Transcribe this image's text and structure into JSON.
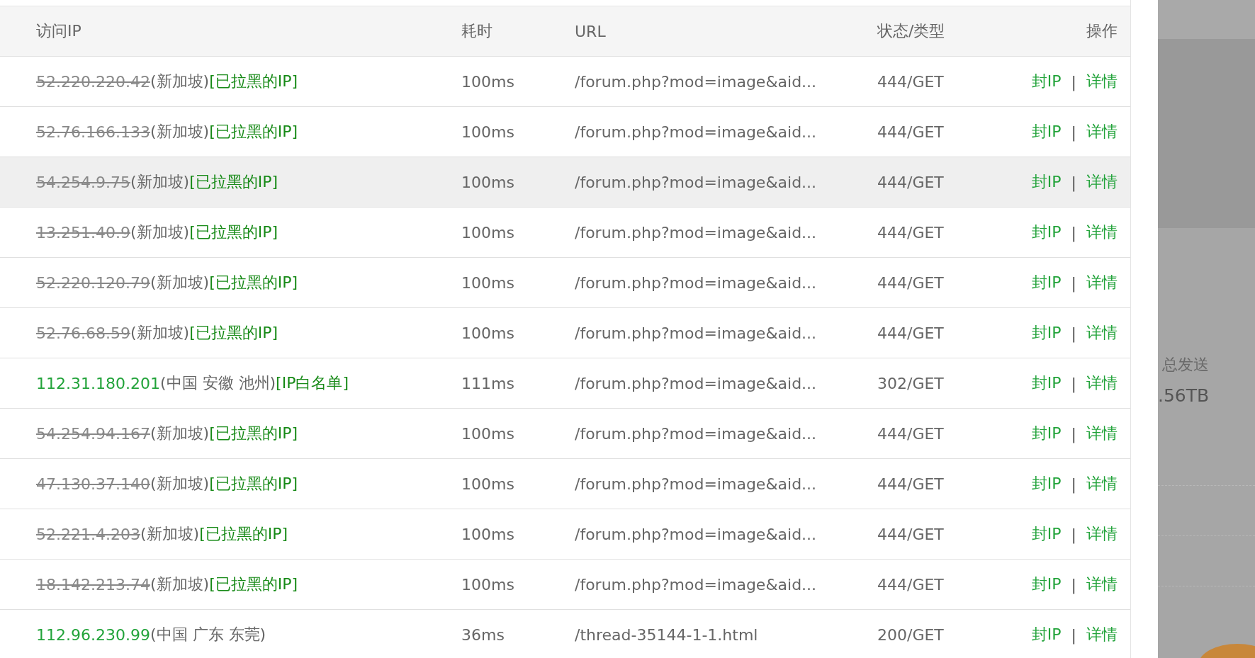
{
  "table": {
    "columns": [
      "访问IP",
      "耗时",
      "URL",
      "状态/类型",
      "操作"
    ],
    "rows": [
      {
        "ip": "52.220.220.42",
        "blacklisted": true,
        "location": "(新加坡)",
        "tag": "[已拉黑的IP]",
        "time": "100ms",
        "url": "/forum.php?mod=image&aid...",
        "status": "444/GET",
        "actions": [
          "封IP",
          "详情"
        ],
        "separator": "|",
        "hovered": false
      },
      {
        "ip": "52.76.166.133",
        "blacklisted": true,
        "location": "(新加坡)",
        "tag": "[已拉黑的IP]",
        "time": "100ms",
        "url": "/forum.php?mod=image&aid...",
        "status": "444/GET",
        "actions": [
          "封IP",
          "详情"
        ],
        "separator": "|",
        "hovered": false
      },
      {
        "ip": "54.254.9.75",
        "blacklisted": true,
        "location": "(新加坡)",
        "tag": "[已拉黑的IP]",
        "time": "100ms",
        "url": "/forum.php?mod=image&aid...",
        "status": "444/GET",
        "actions": [
          "封IP",
          "详情"
        ],
        "separator": "|",
        "hovered": true
      },
      {
        "ip": "13.251.40.9",
        "blacklisted": true,
        "location": "(新加坡)",
        "tag": "[已拉黑的IP]",
        "time": "100ms",
        "url": "/forum.php?mod=image&aid...",
        "status": "444/GET",
        "actions": [
          "封IP",
          "详情"
        ],
        "separator": "|",
        "hovered": false
      },
      {
        "ip": "52.220.120.79",
        "blacklisted": true,
        "location": "(新加坡)",
        "tag": "[已拉黑的IP]",
        "time": "100ms",
        "url": "/forum.php?mod=image&aid...",
        "status": "444/GET",
        "actions": [
          "封IP",
          "详情"
        ],
        "separator": "|",
        "hovered": false
      },
      {
        "ip": "52.76.68.59",
        "blacklisted": true,
        "location": "(新加坡)",
        "tag": "[已拉黑的IP]",
        "time": "100ms",
        "url": "/forum.php?mod=image&aid...",
        "status": "444/GET",
        "actions": [
          "封IP",
          "详情"
        ],
        "separator": "|",
        "hovered": false
      },
      {
        "ip": "112.31.180.201",
        "blacklisted": false,
        "location": "(中国 安徽 池州)",
        "tag": "[IP白名单]",
        "time": "111ms",
        "url": "/forum.php?mod=image&aid...",
        "status": "302/GET",
        "actions": [
          "封IP",
          "详情"
        ],
        "separator": "|",
        "hovered": false
      },
      {
        "ip": "54.254.94.167",
        "blacklisted": true,
        "location": "(新加坡)",
        "tag": "[已拉黑的IP]",
        "time": "100ms",
        "url": "/forum.php?mod=image&aid...",
        "status": "444/GET",
        "actions": [
          "封IP",
          "详情"
        ],
        "separator": "|",
        "hovered": false
      },
      {
        "ip": "47.130.37.140",
        "blacklisted": true,
        "location": "(新加坡)",
        "tag": "[已拉黑的IP]",
        "time": "100ms",
        "url": "/forum.php?mod=image&aid...",
        "status": "444/GET",
        "actions": [
          "封IP",
          "详情"
        ],
        "separator": "|",
        "hovered": false
      },
      {
        "ip": "52.221.4.203",
        "blacklisted": true,
        "location": "(新加坡)",
        "tag": "[已拉黑的IP]",
        "time": "100ms",
        "url": "/forum.php?mod=image&aid...",
        "status": "444/GET",
        "actions": [
          "封IP",
          "详情"
        ],
        "separator": "|",
        "hovered": false
      },
      {
        "ip": "18.142.213.74",
        "blacklisted": true,
        "location": "(新加坡)",
        "tag": "[已拉黑的IP]",
        "time": "100ms",
        "url": "/forum.php?mod=image&aid...",
        "status": "444/GET",
        "actions": [
          "封IP",
          "详情"
        ],
        "separator": "|",
        "hovered": false
      },
      {
        "ip": "112.96.230.99",
        "blacklisted": false,
        "location": "(中国 广东 东莞)",
        "time": "36ms",
        "url": "/thread-35144-1-1.html",
        "status": "200/GET",
        "actions": [
          "封IP",
          "详情"
        ],
        "separator": "|",
        "hovered": false
      }
    ]
  },
  "background_panel": {
    "label": "总发送",
    "value": ".56TB"
  }
}
